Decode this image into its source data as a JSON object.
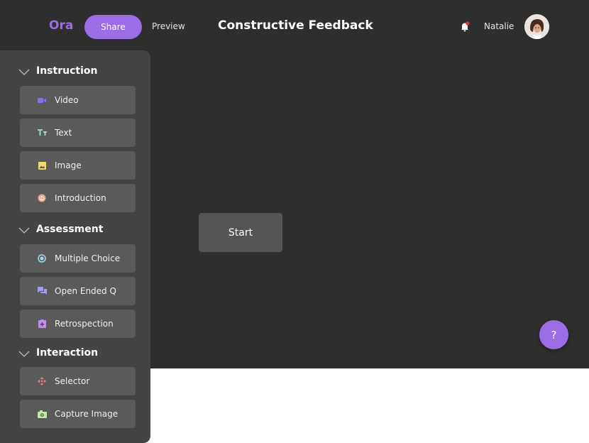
{
  "header": {
    "logo": "Ora",
    "share_label": "Share",
    "preview_label": "Preview",
    "title": "Constructive Feedback",
    "username": "Natalie"
  },
  "sidebar": {
    "sections": [
      {
        "title": "Instruction",
        "items": [
          {
            "label": "Video",
            "icon": "video-icon"
          },
          {
            "label": "Text",
            "icon": "text-icon"
          },
          {
            "label": "Image",
            "icon": "image-icon"
          },
          {
            "label": "Introduction",
            "icon": "introduction-icon"
          }
        ]
      },
      {
        "title": "Assessment",
        "items": [
          {
            "label": "Multiple Choice",
            "icon": "radio-icon"
          },
          {
            "label": "Open Ended Q",
            "icon": "chat-icon"
          },
          {
            "label": "Retrospection",
            "icon": "retrospection-icon"
          }
        ]
      },
      {
        "title": "Interaction",
        "items": [
          {
            "label": "Selector",
            "icon": "selector-icon"
          },
          {
            "label": "Capture Image",
            "icon": "camera-icon"
          }
        ]
      }
    ]
  },
  "main": {
    "start_label": "Start",
    "help_label": "?"
  },
  "colors": {
    "accent": "#9b6ee8",
    "background": "#2e2e2e",
    "sidebar": "#444444",
    "item": "#5a5a5a"
  }
}
